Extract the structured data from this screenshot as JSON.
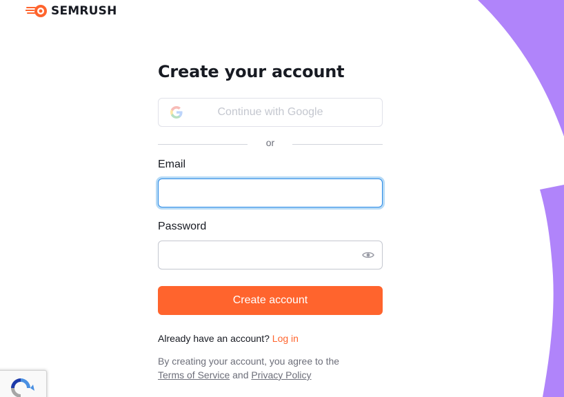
{
  "brand": {
    "name": "SEMRUSH",
    "logo_icon": "semrush-fireball-icon",
    "accent_color": "#ff642d"
  },
  "form": {
    "title": "Create your account",
    "google_button_label": "Continue with Google",
    "google_icon": "google-g-icon",
    "divider_text": "or",
    "email_label": "Email",
    "email_value": "",
    "password_label": "Password",
    "password_value": "",
    "password_toggle_icon": "eye-icon",
    "submit_label": "Create account",
    "login_prompt": "Already have an account?",
    "login_link": "Log in",
    "terms_prefix": "By creating your account, you agree to the",
    "terms_link": "Terms of Service",
    "terms_and": "and",
    "privacy_link": "Privacy Policy"
  },
  "decor": {
    "purple_color": "#b084fa",
    "recaptcha_icon": "recaptcha-icon"
  }
}
